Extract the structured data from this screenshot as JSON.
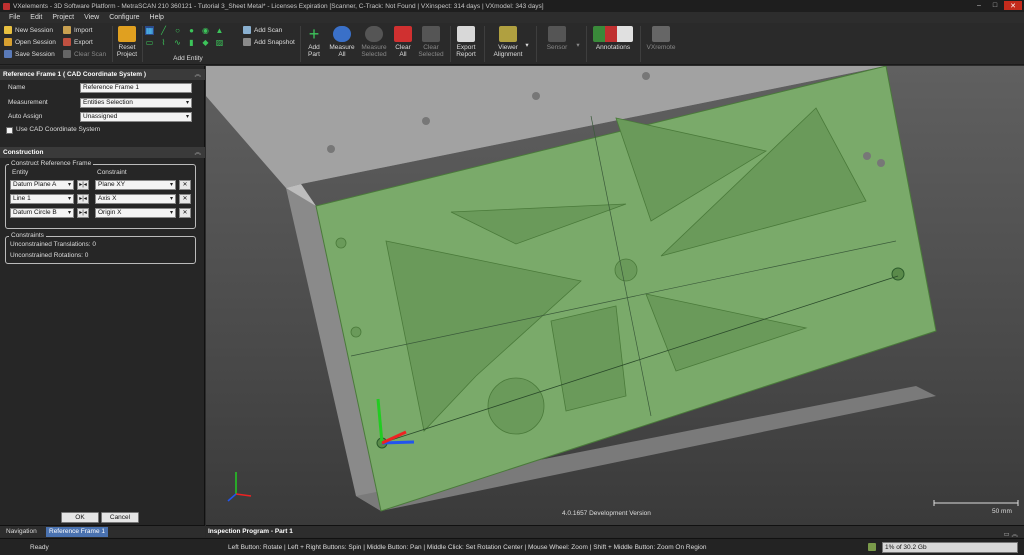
{
  "window": {
    "title": "VXelements - 3D Software Platform - MetraSCAN 210 360121 - Tutorial 3_Sheet Metal* - Licenses Expiration [Scanner, C-Track: Not Found | VXinspect: 314 days | VXmodel: 343 days]",
    "minimize": "–",
    "maximize": "□",
    "close": "✕"
  },
  "menu": [
    "File",
    "Edit",
    "Project",
    "View",
    "Configure",
    "Help"
  ],
  "ribbon": {
    "new_session": "New Session",
    "open_session": "Open Session",
    "save_session": "Save Session",
    "import": "Import",
    "export": "Export",
    "clear_scan": "Clear Scan",
    "reset_project": "Reset\nProject",
    "add_entity": "Add Entity",
    "add_scan": "Add Scan",
    "add_snapshot": "Add Snapshot",
    "add_part": "Add\nPart",
    "measure_all": "Measure\nAll",
    "measure_selected": "Measure\nSelected",
    "clear_all": "Clear\nAll",
    "clear_selected": "Clear\nSelected",
    "export_report": "Export\nReport",
    "viewer_alignment": "Viewer\nAlignment",
    "sensor": "Sensor",
    "annotations": "Annotations",
    "vxremote": "VXremote"
  },
  "panel": {
    "header": "Reference Frame 1 ( CAD Coordinate System )",
    "collapse_glyph": "︽",
    "fields": {
      "name_label": "Name",
      "name_value": "Reference Frame 1",
      "measurement_label": "Measurement",
      "measurement_value": "Entities Selection",
      "auto_assign_label": "Auto Assign",
      "auto_assign_value": "Unassigned",
      "use_cad_label": "Use CAD Coordinate System"
    },
    "construction_header": "Construction",
    "construct_group_title": "Construct Reference Frame",
    "col_entity": "Entity",
    "col_constraint": "Constraint",
    "rows": [
      {
        "entity": "Datum Plane A",
        "constraint": "Plane XY"
      },
      {
        "entity": "Line 1",
        "constraint": "Axis X"
      },
      {
        "entity": "Datum Circle B",
        "constraint": "Origin X"
      }
    ],
    "pair_glyph": "▸|◂",
    "remove_glyph": "✕",
    "dropdown_glyph": "▾",
    "constraints_title": "Constraints",
    "unconstrained_translations": "Unconstrained Translations:  0",
    "unconstrained_rotations": "Unconstrained Rotations:  0",
    "ok": "OK",
    "cancel": "Cancel"
  },
  "tabs": {
    "navigation": "Navigation",
    "reference_frame": "Reference Frame 1"
  },
  "viewport": {
    "version": "4.0.1657 Development Version",
    "scale": "50 mm"
  },
  "inspection": {
    "title": "Inspection Program - Part 1",
    "buttons": "▭ ︽"
  },
  "status": {
    "ready": "Ready",
    "hints": "Left Button: Rotate  |  Left + Right Buttons: Spin  |  Middle Button: Pan  |  Middle Click: Set Rotation Center  |  Mouse Wheel: Zoom  |  Shift + Middle Button: Zoom On Region",
    "memory": "1% of 30.2 Gb"
  },
  "colors": {
    "accent": "#4a72b0",
    "plate": "#7aaa6a",
    "green_icon": "#3cc45a",
    "close_red": "#c42b1c"
  }
}
